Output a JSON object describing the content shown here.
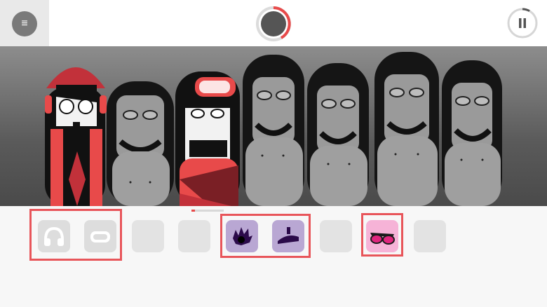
{
  "topbar": {
    "menu_icon": "menu-icon",
    "menu_glyph": "≡",
    "progress_icon": "loop-progress-icon",
    "pause_icon": "pause-icon"
  },
  "colors": {
    "accent_red": "#e8555a",
    "progress_red": "#e84a4a",
    "gray_slot": "#e3e3e3",
    "effects_purple": "#b9a7d3",
    "voices_pink": "#f6b3d7"
  },
  "stage": {
    "performer_count": 7,
    "active_performers": [
      "performer-1-hat-headphones",
      "performer-3-goggles-hoodie"
    ]
  },
  "palette": {
    "slots": [
      {
        "id": "slot-1",
        "icon": "headphones-icon",
        "group": "beats",
        "tint": "#dddddd"
      },
      {
        "id": "slot-2",
        "icon": "goggles-icon",
        "group": "beats",
        "tint": "#dddddd"
      },
      {
        "id": "slot-3",
        "icon": "",
        "group": "none",
        "tint": "#e3e3e3"
      },
      {
        "id": "slot-4",
        "icon": "",
        "group": "none",
        "tint": "#e3e3e3"
      },
      {
        "id": "slot-5",
        "icon": "spiky-hair-icon",
        "group": "effects",
        "tint": "#b9a7d3"
      },
      {
        "id": "slot-6",
        "icon": "flat-cap-icon",
        "group": "effects",
        "tint": "#b9a7d3"
      },
      {
        "id": "slot-7",
        "icon": "",
        "group": "none",
        "tint": "#e3e3e3"
      },
      {
        "id": "slot-8",
        "icon": "sunglasses-icon",
        "group": "voices",
        "tint": "#f6b3d7"
      },
      {
        "id": "slot-9",
        "icon": "",
        "group": "none",
        "tint": "#e3e3e3"
      }
    ]
  }
}
